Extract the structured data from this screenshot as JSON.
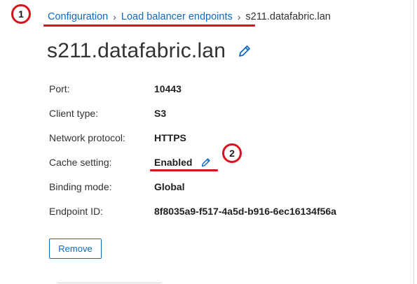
{
  "breadcrumb": {
    "items": [
      "Configuration",
      "Load balancer endpoints"
    ],
    "separator": "›",
    "current": "s211.datafabric.lan"
  },
  "page": {
    "title": "s211.datafabric.lan",
    "title_edit_icon": "pencil-icon"
  },
  "properties": [
    {
      "label": "Port:",
      "value": "10443"
    },
    {
      "label": "Client type:",
      "value": "S3"
    },
    {
      "label": "Network protocol:",
      "value": "HTTPS"
    },
    {
      "label": "Cache setting:",
      "value": "Enabled",
      "edit_icon": "pencil-icon"
    },
    {
      "label": "Binding mode:",
      "value": "Global"
    },
    {
      "label": "Endpoint ID:",
      "value": "8f8035a9-f517-4a5d-b916-6ec16134f56a"
    }
  ],
  "actions": {
    "remove_label": "Remove"
  },
  "annotations": {
    "markers": [
      "1",
      "2"
    ],
    "color": "#d7141e"
  },
  "colors": {
    "link": "#0b6ac3",
    "text": "#323232",
    "accent_annotation": "#d7141e"
  }
}
